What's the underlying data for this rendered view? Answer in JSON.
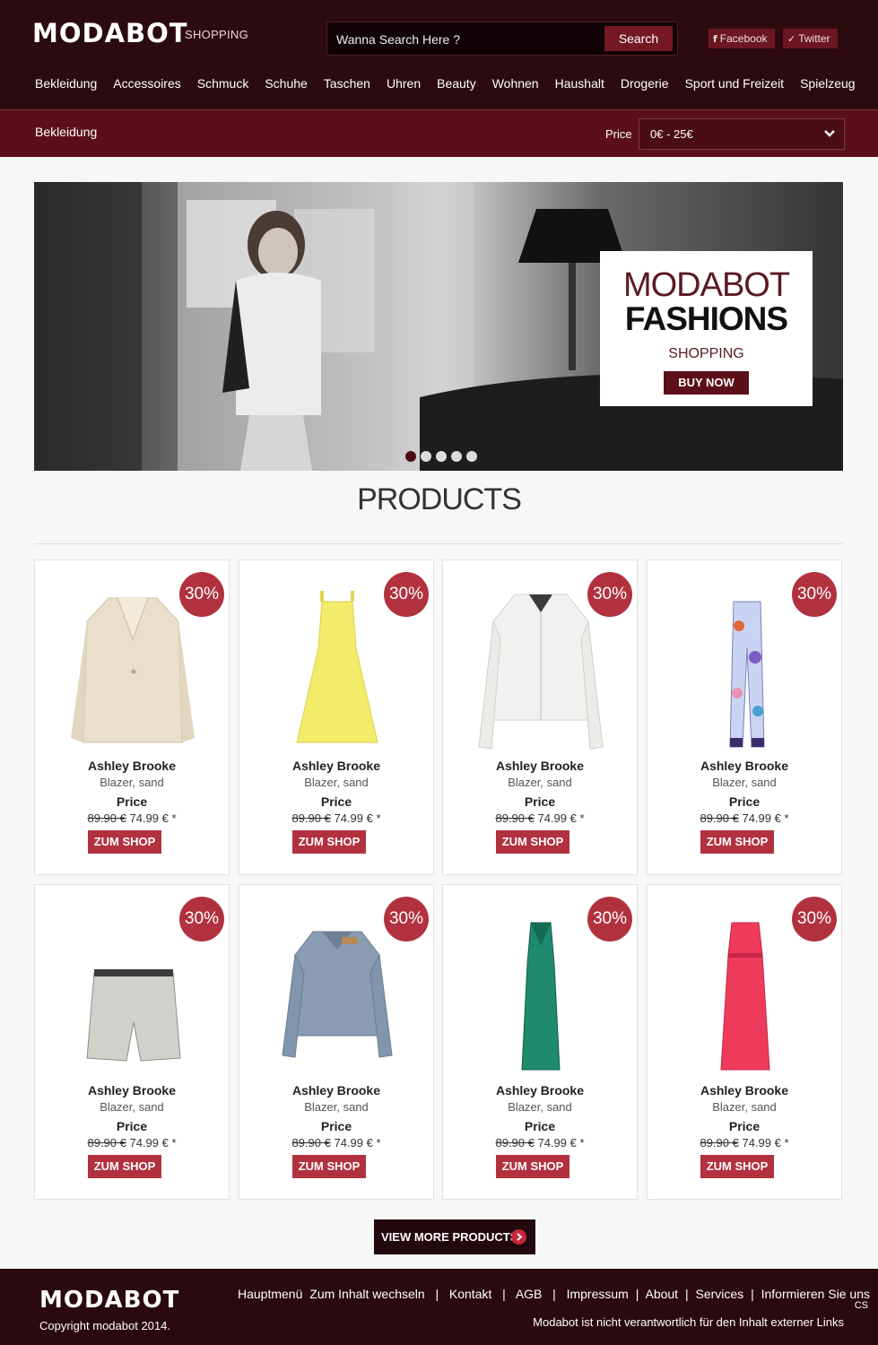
{
  "colors": {
    "header_bg": "#2c0b10",
    "accent": "#741824",
    "badge": "#b1323e",
    "button": "#b1323e"
  },
  "header": {
    "logo": "MODABOT",
    "logo_sub": "SHOPPING",
    "search_placeholder": "Wanna Search Here ?",
    "search_button": "Search",
    "facebook_label": "Facebook",
    "twitter_label": "Twitter",
    "facebook_icon": "facebook-icon",
    "twitter_icon": "twitter-icon"
  },
  "nav": {
    "items": [
      "Bekleidung",
      "Accessoires",
      "Schmuck",
      "Schuhe",
      "Taschen",
      "Uhren",
      "Beauty",
      "Wohnen",
      "Haushalt",
      "Drogerie",
      "Sport und Freizeit",
      "Spielzeug"
    ]
  },
  "filter": {
    "category": "Bekleidung",
    "price_label": "Price",
    "price_value": "0€ - 25€"
  },
  "hero": {
    "brand": "MODABOT",
    "title": "FASHIONS",
    "subtitle": "SHOPPING",
    "cta": "BUY NOW",
    "slide_count": 5,
    "active_slide": 1
  },
  "products": {
    "title": "PRODUCTS",
    "items": [
      {
        "brand": "Ashley Brooke",
        "desc": "Blazer, sand",
        "price_label": "Price",
        "old_price": "89.90 €",
        "new_price": "74.99 € *",
        "discount": "30%",
        "cta": "ZUM SHOP",
        "item": "blazer"
      },
      {
        "brand": "Ashley Brooke",
        "desc": "Blazer, sand",
        "price_label": "Price",
        "old_price": "89.90 €",
        "new_price": "74.99 € *",
        "discount": "30%",
        "cta": "ZUM SHOP",
        "item": "yellow-dress"
      },
      {
        "brand": "Ashley Brooke",
        "desc": "Blazer, sand",
        "price_label": "Price",
        "old_price": "89.90 €",
        "new_price": "74.99 € *",
        "discount": "30%",
        "cta": "ZUM SHOP",
        "item": "white-jacket"
      },
      {
        "brand": "Ashley Brooke",
        "desc": "Blazer, sand",
        "price_label": "Price",
        "old_price": "89.90 €",
        "new_price": "74.99 € *",
        "discount": "30%",
        "cta": "ZUM SHOP",
        "item": "printed-pants"
      },
      {
        "brand": "Ashley Brooke",
        "desc": "Blazer, sand",
        "price_label": "Price",
        "old_price": "89.90 €",
        "new_price": "74.99 € *",
        "discount": "30%",
        "cta": "ZUM SHOP",
        "item": "shorts"
      },
      {
        "brand": "Ashley Brooke",
        "desc": "Blazer, sand",
        "price_label": "Price",
        "old_price": "89.90 €",
        "new_price": "74.99 € *",
        "discount": "30%",
        "cta": "ZUM SHOP",
        "item": "denim-jacket"
      },
      {
        "brand": "Ashley Brooke",
        "desc": "Blazer, sand",
        "price_label": "Price",
        "old_price": "89.90 €",
        "new_price": "74.99 € *",
        "discount": "30%",
        "cta": "ZUM SHOP",
        "item": "green-gown"
      },
      {
        "brand": "Ashley Brooke",
        "desc": "Blazer, sand",
        "price_label": "Price",
        "old_price": "89.90 €",
        "new_price": "74.99 € *",
        "discount": "30%",
        "cta": "ZUM SHOP",
        "item": "red-gown"
      }
    ],
    "view_more": "VIEW MORE PRODUCTS"
  },
  "footer": {
    "logo": "MODABOT",
    "copyright": "Copyright modabot 2014.",
    "links": [
      "Hauptmenü",
      "Zum Inhalt wechseln",
      "Kontakt",
      "AGB",
      "Impressum",
      "About",
      "Services",
      "Informieren Sie uns"
    ],
    "note": "Modabot ist nicht verantwortlich für den Inhalt externer Links",
    "cs": "CS"
  }
}
